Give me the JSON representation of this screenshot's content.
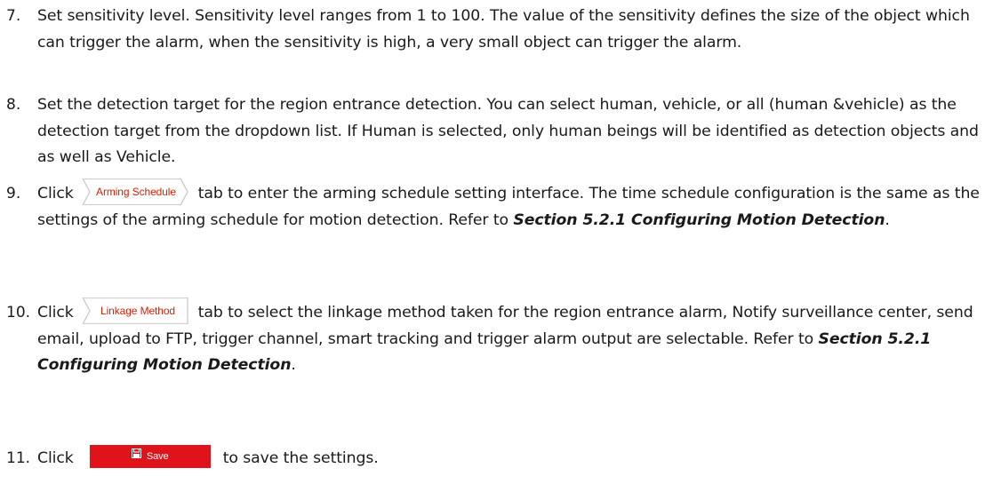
{
  "steps": [
    {
      "number": "7.",
      "text": "Set sensitivity level. Sensitivity level ranges from 1 to 100. The value of the sensitivity defines the size of the object which can trigger the alarm, when the sensitivity is high, a very small object can trigger the alarm."
    },
    {
      "number": "8.",
      "text": "Set the detection target for the region entrance detection. You can select human, vehicle, or all (human &vehicle) as the detection target from the dropdown list. If Human is selected, only human beings will be identified as detection objects and as well as Vehicle."
    },
    {
      "number": "9.",
      "before": "Click",
      "tab_label": "Arming Schedule",
      "after": "tab to enter the arming schedule setting interface. The time schedule configuration is the same as the settings of the arming schedule for motion detection. Refer to",
      "ref": "Section 5.2.1 Configuring Motion Detection",
      "end": "."
    },
    {
      "number": "10.",
      "before": "Click",
      "tab_label": "Linkage Method",
      "after": "tab to select the linkage method taken for the region entrance alarm, Notify surveillance center, send email, upload to FTP, trigger channel, smart tracking and trigger alarm output are selectable. Refer to",
      "ref": "Section 5.2.1 Configuring Motion Detection",
      "end": "."
    },
    {
      "number": "11.",
      "before": "Click",
      "button_label": "Save",
      "after": "to save the settings."
    }
  ],
  "colors": {
    "tab_text": "#d81e06",
    "tab_border": "#c9c9c9",
    "button_bg": "#e0121a",
    "button_text": "#ffffff"
  },
  "icons": {
    "save_button_icon": "floppy-disk-icon"
  }
}
